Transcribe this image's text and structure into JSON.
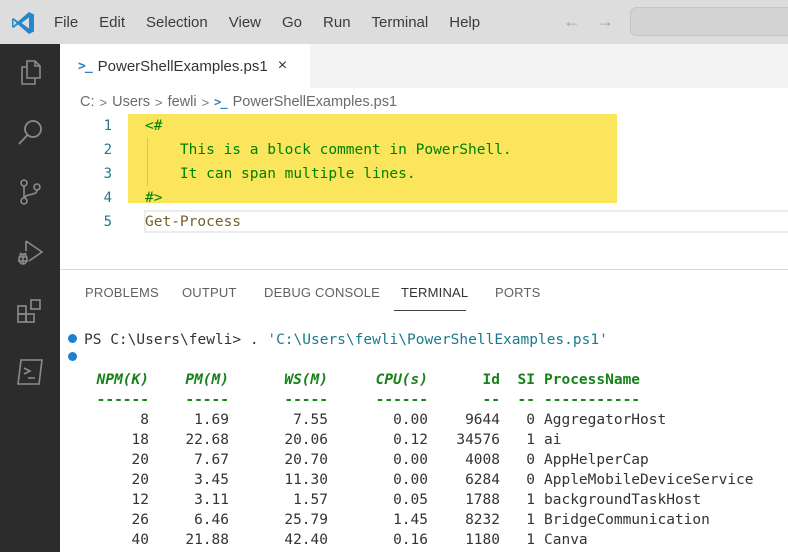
{
  "menu": {
    "items": [
      "File",
      "Edit",
      "Selection",
      "View",
      "Go",
      "Run",
      "Terminal",
      "Help"
    ],
    "back_icon": "arrow-left-icon",
    "forward_icon": "arrow-right-icon",
    "command_center_placeholder": ""
  },
  "activity_bar": {
    "items": [
      {
        "name": "explorer",
        "icon": "files-icon"
      },
      {
        "name": "search",
        "icon": "search-icon"
      },
      {
        "name": "source-control",
        "icon": "source-control-icon"
      },
      {
        "name": "run-and-debug",
        "icon": "run-debug-icon"
      },
      {
        "name": "extensions",
        "icon": "extensions-icon"
      },
      {
        "name": "powershell",
        "icon": "terminal-icon"
      }
    ]
  },
  "tab": {
    "label": "PowerShellExamples.ps1",
    "close": "×"
  },
  "breadcrumb": {
    "parts": [
      "C:",
      "Users",
      "fewli",
      "PowerShellExamples.ps1"
    ],
    "separator": ">"
  },
  "editor": {
    "lines": [
      {
        "number": "1",
        "text": "<#"
      },
      {
        "number": "2",
        "text": "    This is a block comment in PowerShell."
      },
      {
        "number": "3",
        "text": "    It can span multiple lines."
      },
      {
        "number": "4",
        "text": "#>"
      },
      {
        "number": "5",
        "text": "Get-Process"
      }
    ]
  },
  "panel": {
    "tabs": [
      "PROBLEMS",
      "OUTPUT",
      "DEBUG CONSOLE",
      "TERMINAL",
      "PORTS"
    ],
    "active_tab": "TERMINAL"
  },
  "terminal": {
    "prompt": "PS C:\\Users\\fewli> ",
    "command": ". ",
    "command_arg": "'C:\\Users\\fewli\\PowerShellExamples.ps1'",
    "columns": [
      "NPM(K)",
      "PM(M)",
      "WS(M)",
      "CPU(s)",
      "Id",
      "SI",
      "ProcessName"
    ],
    "underlines": [
      "------",
      "-----",
      "-----",
      "------",
      "--",
      "--",
      "-----------"
    ],
    "rows": [
      [
        "8",
        "1.69",
        "7.55",
        "0.00",
        "9644",
        "0",
        "AggregatorHost"
      ],
      [
        "18",
        "22.68",
        "20.06",
        "0.12",
        "34576",
        "1",
        "ai"
      ],
      [
        "20",
        "7.67",
        "20.70",
        "0.00",
        "4008",
        "0",
        "AppHelperCap"
      ],
      [
        "20",
        "3.45",
        "11.30",
        "0.00",
        "6284",
        "0",
        "AppleMobileDeviceService"
      ],
      [
        "12",
        "3.11",
        "1.57",
        "0.05",
        "1788",
        "1",
        "backgroundTaskHost"
      ],
      [
        "26",
        "6.46",
        "25.79",
        "1.45",
        "8232",
        "1",
        "BridgeCommunication"
      ],
      [
        "40",
        "21.88",
        "42.40",
        "0.16",
        "1180",
        "1",
        "Canva"
      ]
    ]
  },
  "colors": {
    "accent": "#1f80d1",
    "highlight": "#fbe55c",
    "comment": "#008000",
    "header": "#168318"
  }
}
